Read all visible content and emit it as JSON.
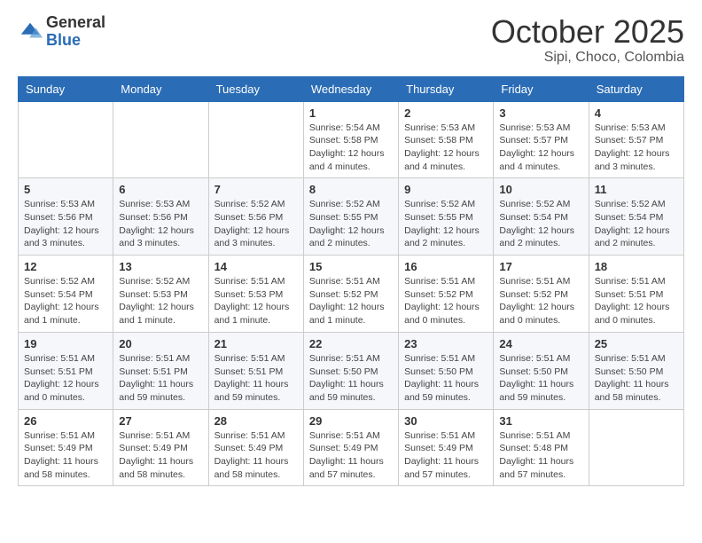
{
  "header": {
    "logo": {
      "general": "General",
      "blue": "Blue"
    },
    "title": "October 2025",
    "subtitle": "Sipi, Choco, Colombia"
  },
  "weekdays": [
    "Sunday",
    "Monday",
    "Tuesday",
    "Wednesday",
    "Thursday",
    "Friday",
    "Saturday"
  ],
  "weeks": [
    [
      {
        "day": null,
        "sunrise": null,
        "sunset": null,
        "daylight": null
      },
      {
        "day": null,
        "sunrise": null,
        "sunset": null,
        "daylight": null
      },
      {
        "day": null,
        "sunrise": null,
        "sunset": null,
        "daylight": null
      },
      {
        "day": 1,
        "sunrise": "Sunrise: 5:54 AM",
        "sunset": "Sunset: 5:58 PM",
        "daylight": "Daylight: 12 hours and 4 minutes."
      },
      {
        "day": 2,
        "sunrise": "Sunrise: 5:53 AM",
        "sunset": "Sunset: 5:58 PM",
        "daylight": "Daylight: 12 hours and 4 minutes."
      },
      {
        "day": 3,
        "sunrise": "Sunrise: 5:53 AM",
        "sunset": "Sunset: 5:57 PM",
        "daylight": "Daylight: 12 hours and 4 minutes."
      },
      {
        "day": 4,
        "sunrise": "Sunrise: 5:53 AM",
        "sunset": "Sunset: 5:57 PM",
        "daylight": "Daylight: 12 hours and 3 minutes."
      }
    ],
    [
      {
        "day": 5,
        "sunrise": "Sunrise: 5:53 AM",
        "sunset": "Sunset: 5:56 PM",
        "daylight": "Daylight: 12 hours and 3 minutes."
      },
      {
        "day": 6,
        "sunrise": "Sunrise: 5:53 AM",
        "sunset": "Sunset: 5:56 PM",
        "daylight": "Daylight: 12 hours and 3 minutes."
      },
      {
        "day": 7,
        "sunrise": "Sunrise: 5:52 AM",
        "sunset": "Sunset: 5:56 PM",
        "daylight": "Daylight: 12 hours and 3 minutes."
      },
      {
        "day": 8,
        "sunrise": "Sunrise: 5:52 AM",
        "sunset": "Sunset: 5:55 PM",
        "daylight": "Daylight: 12 hours and 2 minutes."
      },
      {
        "day": 9,
        "sunrise": "Sunrise: 5:52 AM",
        "sunset": "Sunset: 5:55 PM",
        "daylight": "Daylight: 12 hours and 2 minutes."
      },
      {
        "day": 10,
        "sunrise": "Sunrise: 5:52 AM",
        "sunset": "Sunset: 5:54 PM",
        "daylight": "Daylight: 12 hours and 2 minutes."
      },
      {
        "day": 11,
        "sunrise": "Sunrise: 5:52 AM",
        "sunset": "Sunset: 5:54 PM",
        "daylight": "Daylight: 12 hours and 2 minutes."
      }
    ],
    [
      {
        "day": 12,
        "sunrise": "Sunrise: 5:52 AM",
        "sunset": "Sunset: 5:54 PM",
        "daylight": "Daylight: 12 hours and 1 minute."
      },
      {
        "day": 13,
        "sunrise": "Sunrise: 5:52 AM",
        "sunset": "Sunset: 5:53 PM",
        "daylight": "Daylight: 12 hours and 1 minute."
      },
      {
        "day": 14,
        "sunrise": "Sunrise: 5:51 AM",
        "sunset": "Sunset: 5:53 PM",
        "daylight": "Daylight: 12 hours and 1 minute."
      },
      {
        "day": 15,
        "sunrise": "Sunrise: 5:51 AM",
        "sunset": "Sunset: 5:52 PM",
        "daylight": "Daylight: 12 hours and 1 minute."
      },
      {
        "day": 16,
        "sunrise": "Sunrise: 5:51 AM",
        "sunset": "Sunset: 5:52 PM",
        "daylight": "Daylight: 12 hours and 0 minutes."
      },
      {
        "day": 17,
        "sunrise": "Sunrise: 5:51 AM",
        "sunset": "Sunset: 5:52 PM",
        "daylight": "Daylight: 12 hours and 0 minutes."
      },
      {
        "day": 18,
        "sunrise": "Sunrise: 5:51 AM",
        "sunset": "Sunset: 5:51 PM",
        "daylight": "Daylight: 12 hours and 0 minutes."
      }
    ],
    [
      {
        "day": 19,
        "sunrise": "Sunrise: 5:51 AM",
        "sunset": "Sunset: 5:51 PM",
        "daylight": "Daylight: 12 hours and 0 minutes."
      },
      {
        "day": 20,
        "sunrise": "Sunrise: 5:51 AM",
        "sunset": "Sunset: 5:51 PM",
        "daylight": "Daylight: 11 hours and 59 minutes."
      },
      {
        "day": 21,
        "sunrise": "Sunrise: 5:51 AM",
        "sunset": "Sunset: 5:51 PM",
        "daylight": "Daylight: 11 hours and 59 minutes."
      },
      {
        "day": 22,
        "sunrise": "Sunrise: 5:51 AM",
        "sunset": "Sunset: 5:50 PM",
        "daylight": "Daylight: 11 hours and 59 minutes."
      },
      {
        "day": 23,
        "sunrise": "Sunrise: 5:51 AM",
        "sunset": "Sunset: 5:50 PM",
        "daylight": "Daylight: 11 hours and 59 minutes."
      },
      {
        "day": 24,
        "sunrise": "Sunrise: 5:51 AM",
        "sunset": "Sunset: 5:50 PM",
        "daylight": "Daylight: 11 hours and 59 minutes."
      },
      {
        "day": 25,
        "sunrise": "Sunrise: 5:51 AM",
        "sunset": "Sunset: 5:50 PM",
        "daylight": "Daylight: 11 hours and 58 minutes."
      }
    ],
    [
      {
        "day": 26,
        "sunrise": "Sunrise: 5:51 AM",
        "sunset": "Sunset: 5:49 PM",
        "daylight": "Daylight: 11 hours and 58 minutes."
      },
      {
        "day": 27,
        "sunrise": "Sunrise: 5:51 AM",
        "sunset": "Sunset: 5:49 PM",
        "daylight": "Daylight: 11 hours and 58 minutes."
      },
      {
        "day": 28,
        "sunrise": "Sunrise: 5:51 AM",
        "sunset": "Sunset: 5:49 PM",
        "daylight": "Daylight: 11 hours and 58 minutes."
      },
      {
        "day": 29,
        "sunrise": "Sunrise: 5:51 AM",
        "sunset": "Sunset: 5:49 PM",
        "daylight": "Daylight: 11 hours and 57 minutes."
      },
      {
        "day": 30,
        "sunrise": "Sunrise: 5:51 AM",
        "sunset": "Sunset: 5:49 PM",
        "daylight": "Daylight: 11 hours and 57 minutes."
      },
      {
        "day": 31,
        "sunrise": "Sunrise: 5:51 AM",
        "sunset": "Sunset: 5:48 PM",
        "daylight": "Daylight: 11 hours and 57 minutes."
      },
      {
        "day": null,
        "sunrise": null,
        "sunset": null,
        "daylight": null
      }
    ]
  ]
}
